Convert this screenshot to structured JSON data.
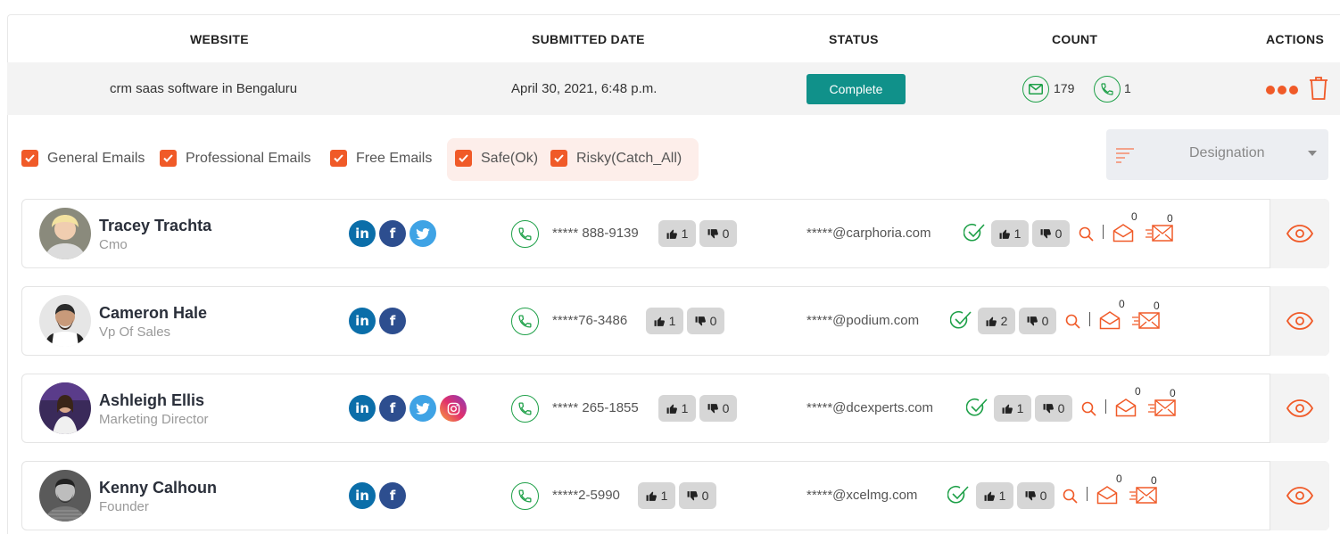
{
  "table": {
    "headers": [
      "WEBSITE",
      "SUBMITTED DATE",
      "STATUS",
      "COUNT",
      "ACTIONS"
    ],
    "row": {
      "website": "crm saas software in Bengaluru",
      "submitted_date": "April 30, 2021, 6:48 p.m.",
      "status": "Complete",
      "email_count": "179",
      "phone_count": "1"
    }
  },
  "filters": [
    {
      "label": "General Emails",
      "checked": true
    },
    {
      "label": "Professional Emails",
      "checked": true
    },
    {
      "label": "Free Emails",
      "checked": true
    },
    {
      "label": "Safe(Ok)",
      "checked": true
    },
    {
      "label": "Risky(Catch_All)",
      "checked": true
    }
  ],
  "designation": {
    "placeholder": "Designation"
  },
  "contacts": [
    {
      "name": "Tracey Trachta",
      "title": "Cmo",
      "socials": [
        "linkedin-icon",
        "facebook-icon",
        "twitter-icon"
      ],
      "phone": "***** 888-9139",
      "phone_up": "1",
      "phone_down": "0",
      "email": "*****@carphoria.com",
      "email_up": "1",
      "email_down": "0",
      "opened": "0",
      "sent": "0"
    },
    {
      "name": "Cameron Hale",
      "title": "Vp Of Sales",
      "socials": [
        "linkedin-icon",
        "facebook-icon"
      ],
      "phone": "*****76-3486",
      "phone_up": "1",
      "phone_down": "0",
      "email": "*****@podium.com",
      "email_up": "2",
      "email_down": "0",
      "opened": "0",
      "sent": "0"
    },
    {
      "name": "Ashleigh Ellis",
      "title": "Marketing Director",
      "socials": [
        "linkedin-icon",
        "facebook-icon",
        "twitter-icon",
        "instagram-icon"
      ],
      "phone": "***** 265-1855",
      "phone_up": "1",
      "phone_down": "0",
      "email": "*****@dcexperts.com",
      "email_up": "1",
      "email_down": "0",
      "opened": "0",
      "sent": "0"
    },
    {
      "name": "Kenny Calhoun",
      "title": "Founder",
      "socials": [
        "linkedin-icon",
        "facebook-icon"
      ],
      "phone": "*****2-5990",
      "phone_up": "1",
      "phone_down": "0",
      "email": "*****@xcelmg.com",
      "email_up": "1",
      "email_down": "0",
      "opened": "0",
      "sent": "0"
    }
  ],
  "colors": {
    "accent": "#f05a28",
    "success": "#1ea048",
    "status_bg": "#10918a"
  }
}
